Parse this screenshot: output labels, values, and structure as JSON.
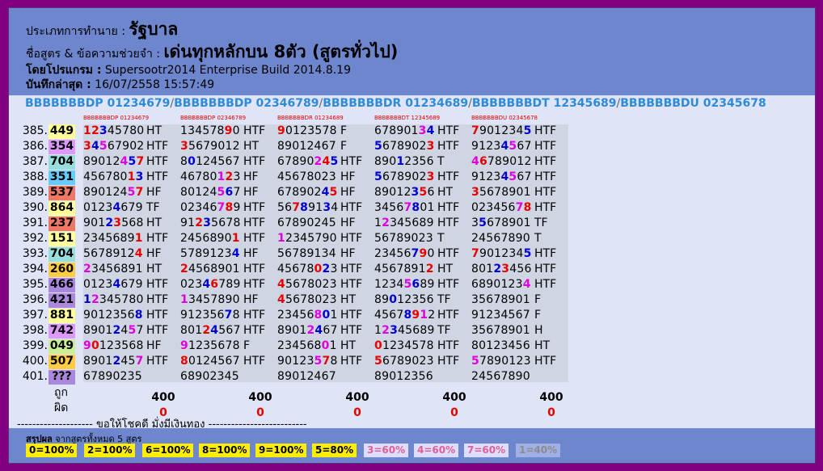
{
  "header": {
    "type_label": "ประเภทการทำนาย :",
    "type_value": "รัฐบาล",
    "formula_label": "ชื่อสูตร & ข้อความช่วยจำ :",
    "formula_value": "เด่นทุกหลักบน 8ตัว (สูตรทั่วไป)",
    "program_label": "โดยโปรแกรม :",
    "program_value": "Supersootr2014 Enterprise Build 2014.8.19",
    "saved_label": "บันทึกล่าสุด :",
    "saved_value": "16/07/2558 15:57:49"
  },
  "formulas": [
    "BBBBBBBDP 01234679",
    "BBBBBBBDP 02346789",
    "BBBBBBBDR 01234689",
    "BBBBBBBDT 12345689",
    "BBBBBBBDU 02345678"
  ],
  "rows": [
    {
      "idx": "385.",
      "num": "449",
      "bg": "#ffff99"
    },
    {
      "idx": "386.",
      "num": "354",
      "bg": "#dd99ff"
    },
    {
      "idx": "387.",
      "num": "704",
      "bg": "#99dddd"
    },
    {
      "idx": "388.",
      "num": "351",
      "bg": "#66ccff"
    },
    {
      "idx": "389.",
      "num": "537",
      "bg": "#ee7766"
    },
    {
      "idx": "390.",
      "num": "864",
      "bg": "#ffff99"
    },
    {
      "idx": "391.",
      "num": "237",
      "bg": "#ee7766"
    },
    {
      "idx": "392.",
      "num": "151",
      "bg": "#ffff99"
    },
    {
      "idx": "393.",
      "num": "704",
      "bg": "#99dddd"
    },
    {
      "idx": "394.",
      "num": "260",
      "bg": "#ffcc44"
    },
    {
      "idx": "395.",
      "num": "466",
      "bg": "#aa88dd"
    },
    {
      "idx": "396.",
      "num": "421",
      "bg": "#aa88dd"
    },
    {
      "idx": "397.",
      "num": "881",
      "bg": "#ffff99"
    },
    {
      "idx": "398.",
      "num": "742",
      "bg": "#dd99ff"
    },
    {
      "idx": "399.",
      "num": "049",
      "bg": "#ccee99"
    },
    {
      "idx": "400.",
      "num": "507",
      "bg": "#ffcc44"
    },
    {
      "idx": "401.",
      "num": "???",
      "bg": "#aa88dd"
    }
  ],
  "columns": [
    {
      "header": "BBBBBBBDP 01234679",
      "cells": [
        {
          "d": "12345780",
          "c": "rrbkkkkk",
          "code": "HT"
        },
        {
          "d": "34567902",
          "c": "rbmkkkkk",
          "code": "HTF"
        },
        {
          "d": "89012457",
          "c": "kkkkkmbr",
          "code": "HTF"
        },
        {
          "d": "45678013",
          "c": "kkkkkkrb",
          "code": "HTF"
        },
        {
          "d": "89012457",
          "c": "kkkkkkmr",
          "code": "HF"
        },
        {
          "d": "01234679",
          "c": "kkkkbkkk",
          "code": "TF"
        },
        {
          "d": "90123568",
          "c": "kkkbrkkk",
          "code": "HT"
        },
        {
          "d": "23456891",
          "c": "kkkkkkkr",
          "code": "HTF"
        },
        {
          "d": "56789124",
          "c": "kkkkkkkr",
          "code": "HF"
        },
        {
          "d": "23456891",
          "c": "mkkkkkkk",
          "code": "HT"
        },
        {
          "d": "01234679",
          "c": "kkkkbkkk",
          "code": "HTF"
        },
        {
          "d": "12345780",
          "c": "bmkkkkkk",
          "code": "HTF"
        },
        {
          "d": "90123568",
          "c": "kkkkkkkb",
          "code": "HTF"
        },
        {
          "d": "89012457",
          "c": "kkkkbkmk",
          "code": "HTF"
        },
        {
          "d": "90123568",
          "c": "mrkkkkkk",
          "code": "HF"
        },
        {
          "d": "89012457",
          "c": "kkkkbkkm",
          "code": "HTF"
        },
        {
          "d": "67890235",
          "c": "kkkkkkkk",
          "code": ""
        }
      ],
      "total": "400",
      "miss": "0"
    },
    {
      "header": "BBBBBBBDP 02346789",
      "cells": [
        {
          "d": "13457890",
          "c": "kkkkkkrk",
          "code": "HTF"
        },
        {
          "d": "35679012",
          "c": "rkkkkkkk",
          "code": "HT"
        },
        {
          "d": "80124567",
          "c": "kbkkkkkk",
          "code": "HTF"
        },
        {
          "d": "46780123",
          "c": "kkkkkmrk",
          "code": "HF"
        },
        {
          "d": "80124567",
          "c": "kkkkkmbk",
          "code": "HF"
        },
        {
          "d": "02346789",
          "c": "kkkkkmrk",
          "code": "HTF"
        },
        {
          "d": "91235678",
          "c": "kkrbkkkk",
          "code": "HTF"
        },
        {
          "d": "24568901",
          "c": "kkkkkkkr",
          "code": "HTF"
        },
        {
          "d": "57891234",
          "c": "kkkkkkkb",
          "code": "HF"
        },
        {
          "d": "24568901",
          "c": "rkkkkkkk",
          "code": "HTF"
        },
        {
          "d": "02346789",
          "c": "kkkbrkkk",
          "code": "HTF"
        },
        {
          "d": "13457890",
          "c": "mkkkkkkk",
          "code": "HF"
        },
        {
          "d": "91235678",
          "c": "kkkkkkbk",
          "code": "HTF"
        },
        {
          "d": "80124567",
          "c": "kkkrbkkk",
          "code": "HTF"
        },
        {
          "d": "91235678",
          "c": "mkkkkkkk",
          "code": "F"
        },
        {
          "d": "80124567",
          "c": "rkkkkkkk",
          "code": "HTF"
        },
        {
          "d": "68902345",
          "c": "kkkkkkkk",
          "code": ""
        }
      ],
      "total": "400",
      "miss": "0"
    },
    {
      "header": "BBBBBBBDR 01234689",
      "cells": [
        {
          "d": "90123578",
          "c": "rkkkkkkk",
          "code": "F"
        },
        {
          "d": "89012467",
          "c": "kkkkkkkk",
          "code": "F"
        },
        {
          "d": "67890245",
          "c": "kkkkkmrb",
          "code": "HTF"
        },
        {
          "d": "45678023",
          "c": "kkkkkkkk",
          "code": "HF"
        },
        {
          "d": "67890245",
          "c": "kkkkkkbr",
          "code": "HF"
        },
        {
          "d": "56789134",
          "c": "kkrbkkbk",
          "code": "HTF"
        },
        {
          "d": "67890245",
          "c": "kkkkkkkk",
          "code": "HF"
        },
        {
          "d": "12345790",
          "c": "mkkkkkkk",
          "code": "HTF"
        },
        {
          "d": "56789134",
          "c": "kkkkkkkk",
          "code": "HF"
        },
        {
          "d": "45678023",
          "c": "kkkkkrbk",
          "code": "HTF"
        },
        {
          "d": "45678023",
          "c": "rkkkkkkk",
          "code": "HTF"
        },
        {
          "d": "45678023",
          "c": "rkkkkkkk",
          "code": "HT"
        },
        {
          "d": "23456801",
          "c": "kkkkkmbk",
          "code": "HTF"
        },
        {
          "d": "89012467",
          "c": "kkkkmbkk",
          "code": "HTF"
        },
        {
          "d": "23456801",
          "c": "kkkkkkmk",
          "code": "HT"
        },
        {
          "d": "90123578",
          "c": "kkkkkmrk",
          "code": "HTF"
        },
        {
          "d": "89012467",
          "c": "kkkkkkkk",
          "code": ""
        }
      ],
      "total": "400",
      "miss": "0"
    },
    {
      "header": "BBBBBBBDT 12345689",
      "cells": [
        {
          "d": "67890134",
          "c": "kkkkkkmb",
          "code": "HTF"
        },
        {
          "d": "56789023",
          "c": "bkkkkkkr",
          "code": "HTF"
        },
        {
          "d": "89012356",
          "c": "kkkbkkkk",
          "code": "T"
        },
        {
          "d": "56789023",
          "c": "bkkkkkkr",
          "code": "HTF"
        },
        {
          "d": "89012356",
          "c": "kkkkkbrk",
          "code": "HT"
        },
        {
          "d": "34567801",
          "c": "kkkkmbkk",
          "code": "HTF"
        },
        {
          "d": "12345689",
          "c": "kmkkkkkk",
          "code": "HTF"
        },
        {
          "d": "56789023",
          "c": "kkkkkkkk",
          "code": "T"
        },
        {
          "d": "23456790",
          "c": "kkkkkbrk",
          "code": "HTF"
        },
        {
          "d": "45678912",
          "c": "kkkkkkkr",
          "code": "HT"
        },
        {
          "d": "12345689",
          "c": "kkkkmbkk",
          "code": "HTF"
        },
        {
          "d": "89012356",
          "c": "kkbkkkkk",
          "code": "TF"
        },
        {
          "d": "45678912",
          "c": "kkkkbrmk",
          "code": "HTF"
        },
        {
          "d": "12345689",
          "c": "kmbkkkkk",
          "code": "TF"
        },
        {
          "d": "01234578",
          "c": "rkkkkkkk",
          "code": "HTF"
        },
        {
          "d": "56789023",
          "c": "rkkkkkkk",
          "code": "HTF"
        },
        {
          "d": "89012356",
          "c": "kkkkkkkk",
          "code": ""
        }
      ],
      "total": "400",
      "miss": "0"
    },
    {
      "header": "BBBBBBBDU 02345678",
      "cells": [
        {
          "d": "79012345",
          "c": "rkkkkkkb",
          "code": "HTF"
        },
        {
          "d": "91234567",
          "c": "kkkkbmkk",
          "code": "HTF"
        },
        {
          "d": "46789012",
          "c": "mrkkkkkk",
          "code": "HTF"
        },
        {
          "d": "91234567",
          "c": "kkkkbmkk",
          "code": "HTF"
        },
        {
          "d": "35678901",
          "c": "rkkkkkkk",
          "code": "HTF"
        },
        {
          "d": "02345678",
          "c": "kkkkkkmr",
          "code": "HTF"
        },
        {
          "d": "35678901",
          "c": "kbkkkkkk",
          "code": "TF"
        },
        {
          "d": "24567890",
          "c": "kkkkkkkk",
          "code": "T"
        },
        {
          "d": "79012345",
          "c": "rkkkkkkb",
          "code": "HTF"
        },
        {
          "d": "80123456",
          "c": "kkkbrkkk",
          "code": "HTF"
        },
        {
          "d": "68901234",
          "c": "kkkkkkkm",
          "code": "HTF"
        },
        {
          "d": "35678901",
          "c": "kkkkkkkk",
          "code": "F"
        },
        {
          "d": "91234567",
          "c": "kkkkkkkk",
          "code": "F"
        },
        {
          "d": "35678901",
          "c": "kkkkkkkk",
          "code": "H"
        },
        {
          "d": "80123456",
          "c": "kkkkkkkk",
          "code": "HT"
        },
        {
          "d": "57890123",
          "c": "mkkkkkkk",
          "code": "HTF"
        },
        {
          "d": "24567890",
          "c": "kkkkkkkk",
          "code": ""
        }
      ],
      "total": "400",
      "miss": "0"
    }
  ],
  "labels": {
    "hit": "ถูก",
    "miss": "ผิด"
  },
  "footer_line": "-------------------- ขอให้โชคดี มั่งมีเงินทอง --------------------------",
  "summary": {
    "title_bold": "สรุปผล",
    "title_rest": "จากสูตรทั้งหมด 5 สูตร",
    "badges": [
      {
        "text": "0=100%",
        "bg": "#ffee00",
        "color": "#000"
      },
      {
        "text": "2=100%",
        "bg": "#ffee00",
        "color": "#000"
      },
      {
        "text": "6=100%",
        "bg": "#ffee00",
        "color": "#000"
      },
      {
        "text": "8=100%",
        "bg": "#ffee00",
        "color": "#000"
      },
      {
        "text": "9=100%",
        "bg": "#ffee00",
        "color": "#000"
      },
      {
        "text": "5=80%",
        "bg": "#ffee00",
        "color": "#000"
      },
      {
        "text": "3=60%",
        "bg": "#ddddff",
        "color": "#e06090"
      },
      {
        "text": "4=60%",
        "bg": "#ddddff",
        "color": "#e06090"
      },
      {
        "text": "7=60%",
        "bg": "#ddddff",
        "color": "#e06090"
      },
      {
        "text": "1=40%",
        "bg": "#9fb0e6",
        "color": "#8c8c8c"
      }
    ]
  }
}
